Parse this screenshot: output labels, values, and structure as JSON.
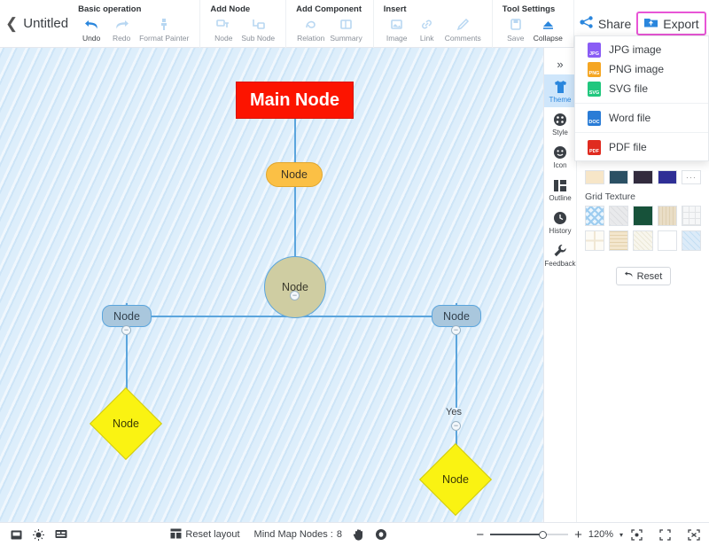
{
  "header": {
    "back_icon": "chevron-left-icon",
    "title": "Untitled",
    "groups": [
      {
        "title": "Basic operation",
        "items": [
          {
            "label": "Undo",
            "icon": "undo-arrow-icon",
            "enabled": true
          },
          {
            "label": "Redo",
            "icon": "redo-arrow-icon",
            "enabled": false
          },
          {
            "label": "Format Painter",
            "icon": "paint-brush-icon",
            "enabled": false
          }
        ]
      },
      {
        "title": "Add Node",
        "items": [
          {
            "label": "Node",
            "icon": "node-icon",
            "enabled": false
          },
          {
            "label": "Sub Node",
            "icon": "sub-node-icon",
            "enabled": false
          }
        ]
      },
      {
        "title": "Add Component",
        "items": [
          {
            "label": "Relation",
            "icon": "relation-arrow-icon",
            "enabled": false
          },
          {
            "label": "Summary",
            "icon": "summary-bracket-icon",
            "enabled": false
          }
        ]
      },
      {
        "title": "Insert",
        "items": [
          {
            "label": "Image",
            "icon": "image-icon",
            "enabled": false
          },
          {
            "label": "Link",
            "icon": "link-chain-icon",
            "enabled": false
          },
          {
            "label": "Comments",
            "icon": "comment-pencil-icon",
            "enabled": false
          }
        ]
      },
      {
        "title": "Tool Settings",
        "items": [
          {
            "label": "Save",
            "icon": "floppy-disk-icon",
            "enabled": false
          },
          {
            "label": "Collapse",
            "icon": "collapse-triangle-icon",
            "enabled": true
          }
        ]
      }
    ],
    "share_label": "Share",
    "share_icon": "share-network-icon",
    "export_label": "Export",
    "export_icon": "export-cloud-folder-icon",
    "export_highlight_color": "#e855d6"
  },
  "export_menu": {
    "groups": [
      [
        {
          "label": "JPG image",
          "icon": "jpg-file-icon",
          "color": "#8a5cf5",
          "tag": "JPG"
        },
        {
          "label": "PNG image",
          "icon": "png-file-icon",
          "color": "#f5a623",
          "tag": "PNG"
        },
        {
          "label": "SVG file",
          "icon": "svg-file-icon",
          "color": "#21c77e",
          "tag": "SVG"
        }
      ],
      [
        {
          "label": "Word file",
          "icon": "word-file-icon",
          "color": "#2a7cd6",
          "tag": "DOC"
        }
      ],
      [
        {
          "label": "PDF file",
          "icon": "pdf-file-icon",
          "color": "#e02b20",
          "tag": "PDF"
        }
      ]
    ]
  },
  "canvas": {
    "background_color": "#ddeefb",
    "edge_color": "#5ba5dd",
    "nodes": [
      {
        "id": "main",
        "text": "Main Node",
        "shape": "rect",
        "fill": "#fc1400",
        "text_color": "#ffffff"
      },
      {
        "id": "n1",
        "text": "Node",
        "shape": "pill",
        "fill": "#fbc045",
        "text_color": "#3b3326"
      },
      {
        "id": "n2",
        "text": "Node",
        "shape": "circle",
        "fill": "#cfcda2",
        "text_color": "#3b3a2d"
      },
      {
        "id": "n3",
        "text": "Node",
        "shape": "round-rect",
        "fill": "#a9c7dd",
        "text_color": "#33414d"
      },
      {
        "id": "n4",
        "text": "Node",
        "shape": "round-rect",
        "fill": "#a9c7dd",
        "text_color": "#33414d"
      },
      {
        "id": "n5",
        "text": "Node",
        "shape": "diamond",
        "fill": "#faf312",
        "text_color": "#3c3a05"
      },
      {
        "id": "n6",
        "text": "Node",
        "shape": "diamond",
        "fill": "#faf312",
        "text_color": "#3c3a05"
      }
    ],
    "edge_labels": [
      {
        "id": "yes",
        "text": "Yes"
      }
    ],
    "collapse_handle_glyph": "−"
  },
  "right_rail": {
    "toggle_icon": "chevron-double-right-icon",
    "items": [
      {
        "label": "Theme",
        "icon": "tshirt-icon",
        "active": true
      },
      {
        "label": "Style",
        "icon": "palette-icon",
        "active": false
      },
      {
        "label": "Icon",
        "icon": "smiley-icon",
        "active": false
      },
      {
        "label": "Outline",
        "icon": "outline-grid-icon",
        "active": false
      },
      {
        "label": "History",
        "icon": "clock-icon",
        "active": false
      },
      {
        "label": "Feedback",
        "icon": "wrench-icon",
        "active": false
      }
    ]
  },
  "theme_panel": {
    "color_swatches": [
      "#f7e6c8",
      "#2b5064",
      "#322b3e",
      "#2f2f96"
    ],
    "more_swatch_label": "···",
    "grid_texture_title": "Grid Texture",
    "grid_textures_row1": [
      "#d7ecfb",
      "#e8e9ea",
      "#17523a",
      "#e9ddc6",
      "#f4f5f6"
    ],
    "grid_textures_row2": [
      "#fdfaf3",
      "#f3e6cd",
      "#f7f5ec",
      "#ffffff",
      "#dcebf8"
    ],
    "reset_label": "Reset",
    "reset_icon": "undo-arrow-icon"
  },
  "statusbar": {
    "left_icons": [
      {
        "icon": "save-image-icon"
      },
      {
        "icon": "brightness-sun-icon"
      },
      {
        "icon": "presentation-icon"
      }
    ],
    "reset_layout_label": "Reset layout",
    "reset_layout_icon": "reset-layout-grid-icon",
    "nodes_count_label": "Mind Map Nodes :",
    "nodes_count_value": "8",
    "hand_icon": "hand-pan-icon",
    "eye_icon": "eye-view-icon",
    "zoom_out_glyph": "−",
    "zoom_in_glyph": "+",
    "zoom_level": "120%",
    "zoom_caret": "▾",
    "fit_icon": "fit-center-icon",
    "expand_icon": "expand-corners-icon",
    "fullscreen_icon": "fullscreen-icon"
  }
}
